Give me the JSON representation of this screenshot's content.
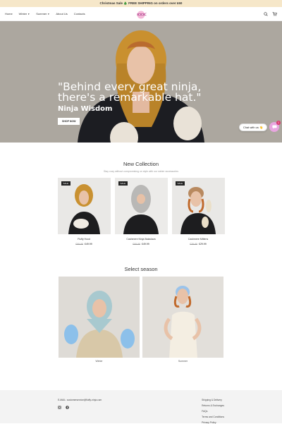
{
  "announcement": "Christmas Sale 🎄 FREE SHIPPING on orders over £60",
  "nav": {
    "items": [
      {
        "label": "Home",
        "caret": false
      },
      {
        "label": "Winter",
        "caret": true
      },
      {
        "label": "Summer",
        "caret": true
      },
      {
        "label": "About Us",
        "caret": false
      },
      {
        "label": "Contacts",
        "caret": false
      }
    ]
  },
  "hero": {
    "quote": "\"Behind every great ninja, there's a remarkable hat.\"",
    "subtitle": "Ninja Wisdom",
    "button": "SHOP NOW"
  },
  "chat": {
    "label": "Chat with us 👋",
    "badge": "1"
  },
  "new_collection": {
    "title": "New Collection",
    "subtitle": "Stay cozy without compromising on style with our winter accessories",
    "products": [
      {
        "name": "Fluffy Hood",
        "old_price": "£69.99",
        "price": "£49.99",
        "sale": "SALE"
      },
      {
        "name": "Cashmere Ninja Balaclava",
        "old_price": "£69.99",
        "price": "£49.99",
        "sale": "SALE"
      },
      {
        "name": "Cashmere Mittens",
        "old_price": "£39.99",
        "price": "£29.99",
        "sale": "SALE"
      }
    ]
  },
  "seasons": {
    "title": "Select season",
    "items": [
      {
        "label": "Winter"
      },
      {
        "label": "Summer"
      }
    ]
  },
  "footer": {
    "email": "E-MAIL: customerservice@fluffy-ninja.com",
    "links": [
      "Shipping & Delivery",
      "Returns & Exchanges",
      "FAQs",
      "Terms and Conditions",
      "Privacy Policy"
    ]
  },
  "colors": {
    "announce_bg": "#f6e7c9",
    "hero_text": "#ffffff",
    "chat_accent": "#e8a6e0"
  }
}
